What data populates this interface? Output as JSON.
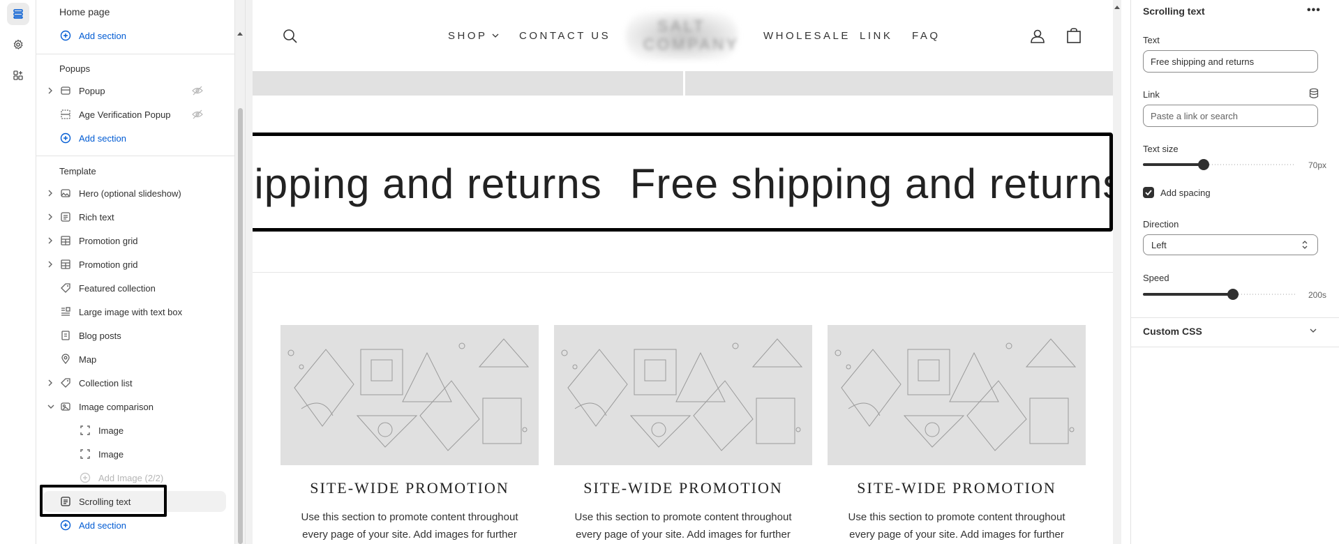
{
  "rail": {
    "icons": [
      "sections-icon",
      "settings-gear-icon",
      "apps-icon"
    ]
  },
  "sidebar": {
    "home_title": "Home page",
    "header_add_section": "Add section",
    "popups": {
      "title": "Popups",
      "items": [
        {
          "label": "Popup",
          "hidden": true
        },
        {
          "label": "Age Verification Popup",
          "hidden": true
        }
      ],
      "add_section": "Add section"
    },
    "template": {
      "title": "Template",
      "items": [
        {
          "label": "Hero (optional slideshow)",
          "expandable": true
        },
        {
          "label": "Rich text",
          "expandable": true
        },
        {
          "label": "Promotion grid",
          "expandable": true
        },
        {
          "label": "Promotion grid",
          "expandable": true
        },
        {
          "label": "Featured collection",
          "expandable": false
        },
        {
          "label": "Large image with text box",
          "expandable": false
        },
        {
          "label": "Blog posts",
          "expandable": false
        },
        {
          "label": "Map",
          "expandable": false
        },
        {
          "label": "Collection list",
          "expandable": true
        },
        {
          "label": "Image comparison",
          "expandable": true,
          "expanded": true
        }
      ],
      "children": [
        {
          "label": "Image"
        },
        {
          "label": "Image"
        },
        {
          "label": "Add Image (2/2)"
        }
      ],
      "selected": "Scrolling text",
      "add_section": "Add section"
    }
  },
  "preview": {
    "nav": [
      "SHOP",
      "CONTACT US",
      "WHOLESALE",
      "LINK",
      "FAQ"
    ],
    "logo_text": "SALT COMPANY",
    "marquee": [
      "hipping and returns",
      "Free shipping and returns"
    ],
    "promos": [
      {
        "title": "SITE-WIDE PROMOTION",
        "text": "Use this section to promote content throughout every page of your site. Add images for further"
      },
      {
        "title": "SITE-WIDE PROMOTION",
        "text": "Use this section to promote content throughout every page of your site. Add images for further"
      },
      {
        "title": "SITE-WIDE PROMOTION",
        "text": "Use this section to promote content throughout every page of your site. Add images for further"
      }
    ]
  },
  "panel": {
    "title": "Scrolling text",
    "text_label": "Text",
    "text_value": "Free shipping and returns",
    "link_label": "Link",
    "link_placeholder": "Paste a link or search",
    "text_size_label": "Text size",
    "text_size_value": "70px",
    "text_size_fraction": 0.4,
    "add_spacing_label": "Add spacing",
    "add_spacing_checked": true,
    "direction_label": "Direction",
    "direction_value": "Left",
    "speed_label": "Speed",
    "speed_value": "200s",
    "speed_fraction": 0.59,
    "custom_css_label": "Custom CSS"
  }
}
